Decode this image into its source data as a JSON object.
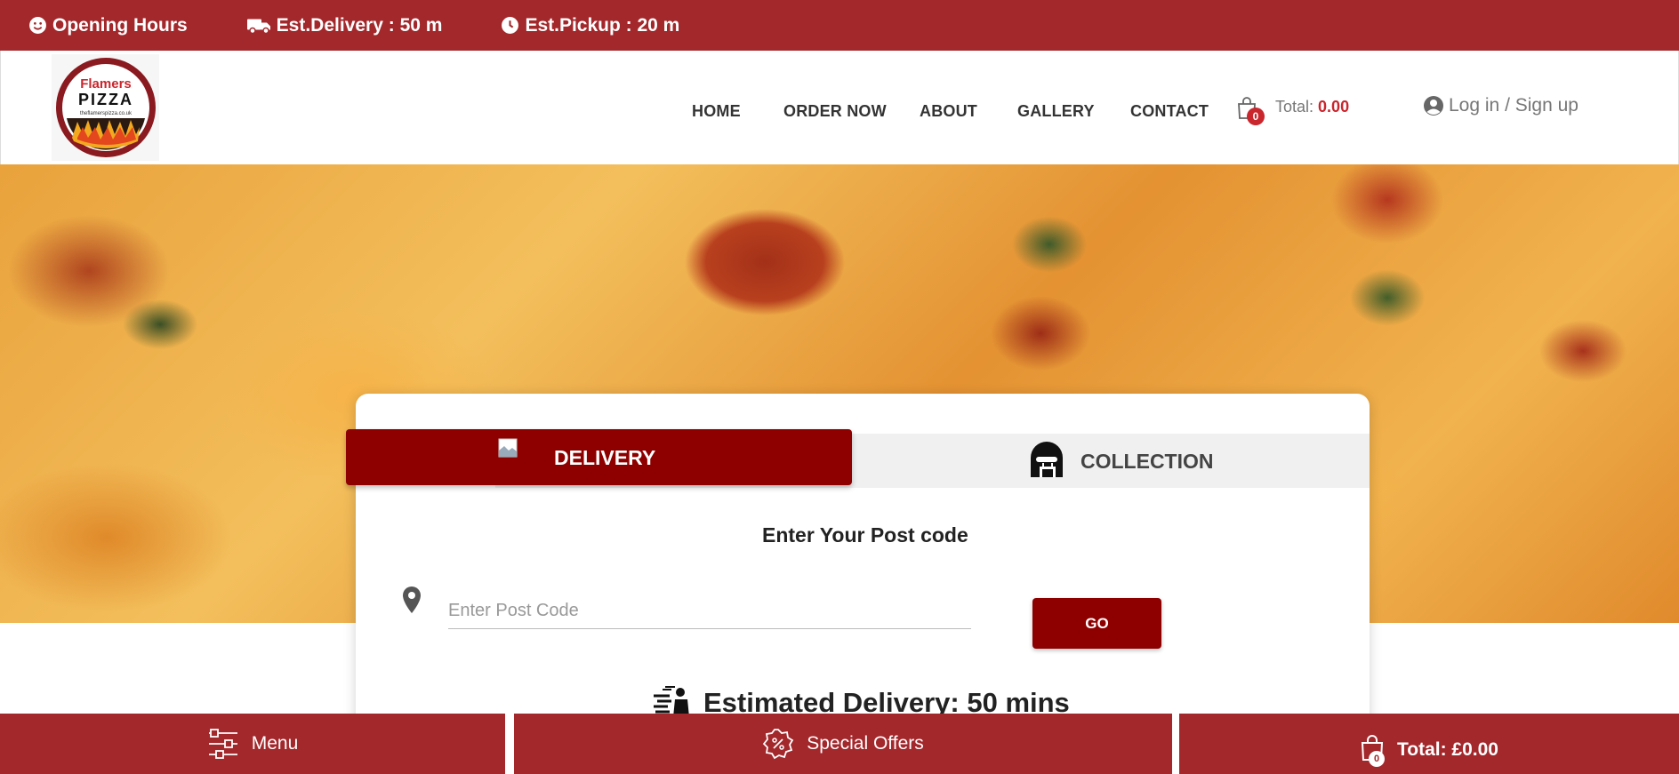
{
  "topbar": {
    "opening_hours": "Opening Hours",
    "est_delivery": "Est.Delivery : 50 m",
    "est_pickup": "Est.Pickup : 20 m"
  },
  "logo": {
    "line1": "Flamers",
    "line2": "PIZZA",
    "url": "theflamerspizza.co.uk"
  },
  "nav": {
    "home": "HOME",
    "order_now": "ORDER NOW",
    "about": "ABOUT",
    "gallery": "GALLERY",
    "contact": "CONTACT"
  },
  "cart": {
    "count": "0",
    "total_label": "Total:",
    "total_value": "0.00"
  },
  "account": {
    "login": "Log in",
    "separator": "/",
    "signup": "Sign up"
  },
  "order_panel": {
    "tab_delivery": "DELIVERY",
    "tab_collection": "COLLECTION",
    "postcode_title": "Enter Your Post code",
    "postcode_placeholder": "Enter Post Code",
    "go_label": "GO",
    "estimated": "Estimated Delivery: 50 mins"
  },
  "bottom_bar": {
    "menu": "Menu",
    "special_offers": "Special Offers",
    "cart_count": "0",
    "total": "Total: £0.00"
  },
  "colors": {
    "brand_red": "#a3282c",
    "dark_red": "#8e0000",
    "accent": "#c9262d"
  }
}
